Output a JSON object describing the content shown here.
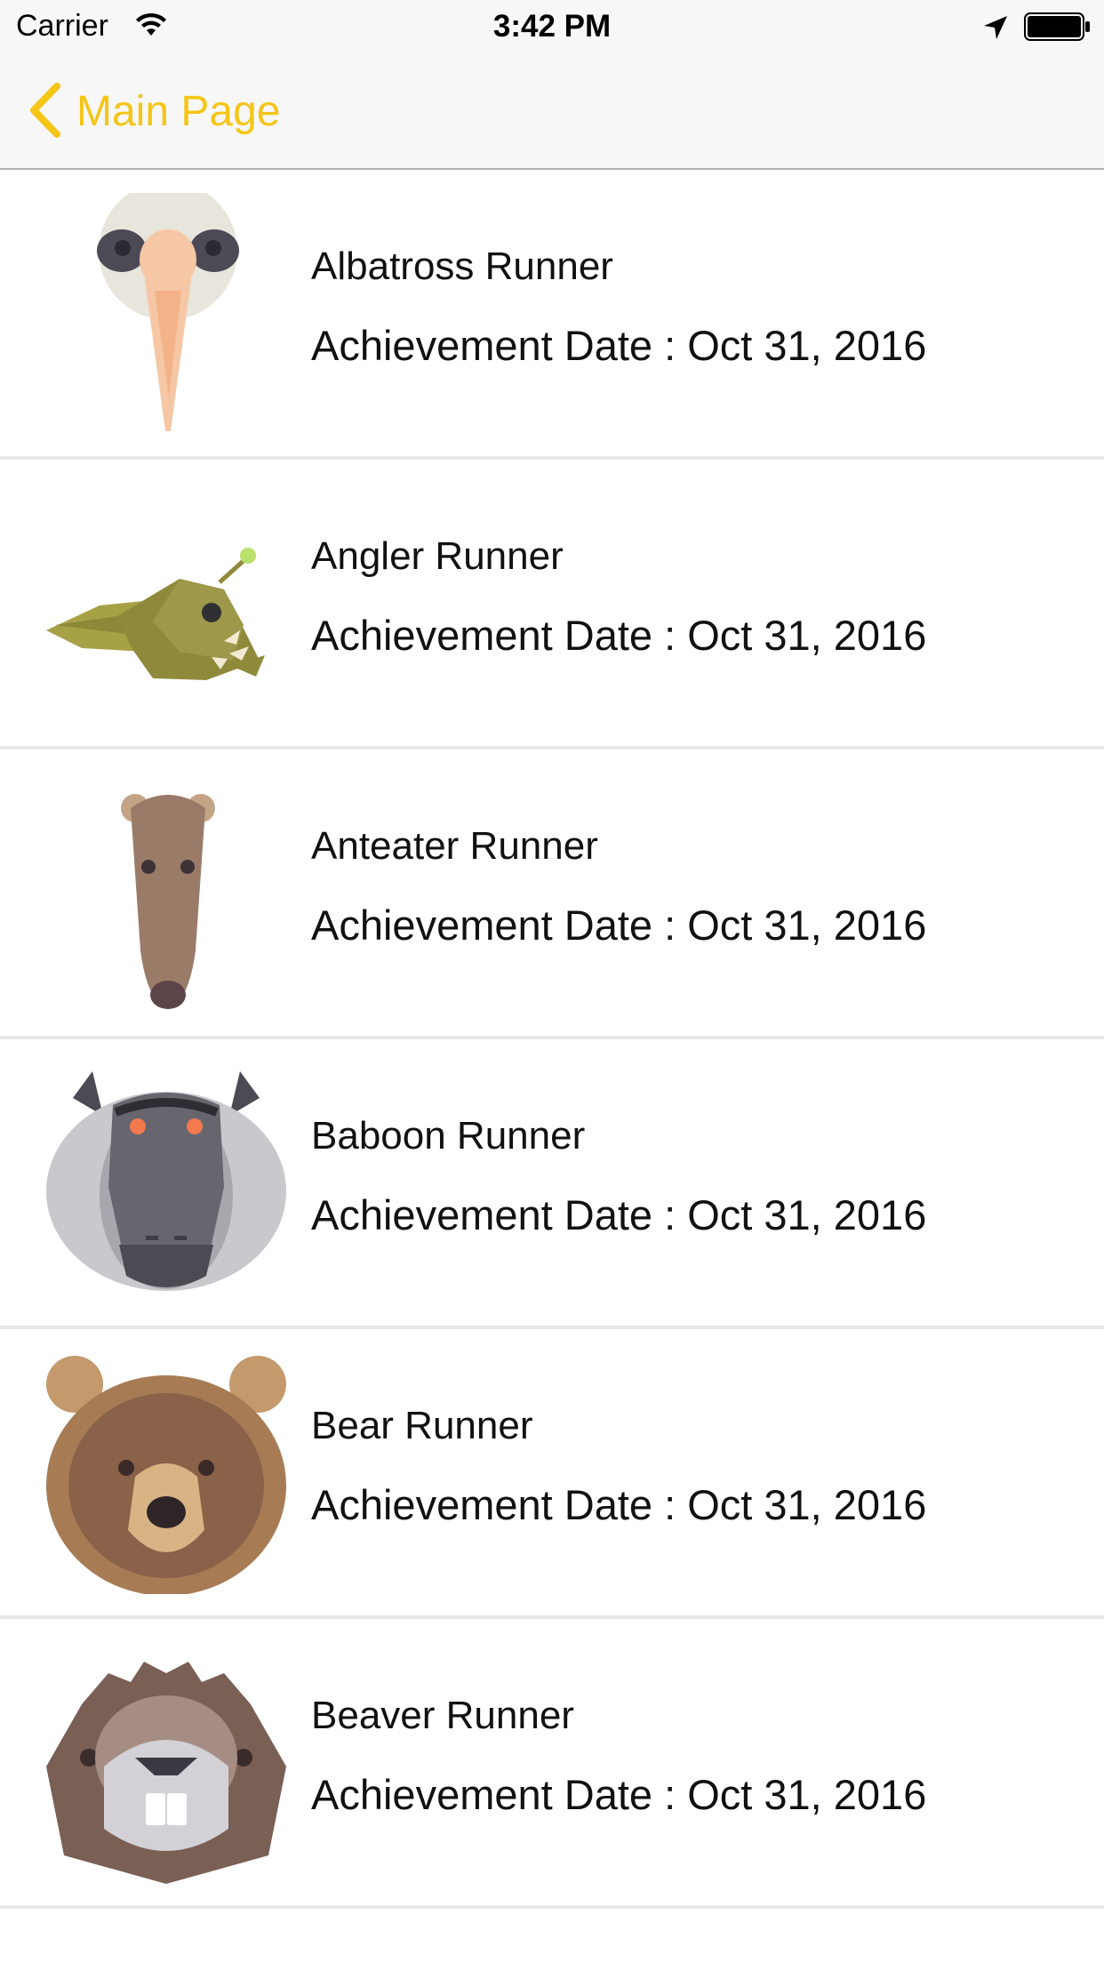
{
  "status_bar": {
    "carrier": "Carrier",
    "time": "3:42 PM",
    "wifi_icon": "wifi-icon",
    "location_icon": "location-arrow-icon",
    "battery_icon": "battery-icon"
  },
  "nav": {
    "back_label": "Main Page",
    "back_icon": "chevron-left-icon",
    "accent_color": "#f5c518"
  },
  "achievements": [
    {
      "title": "Albatross Runner",
      "date": "Achievement Date : Oct 31, 2016",
      "icon": "albatross-icon"
    },
    {
      "title": "Angler Runner",
      "date": "Achievement Date : Oct 31, 2016",
      "icon": "anglerfish-icon"
    },
    {
      "title": "Anteater Runner",
      "date": "Achievement Date : Oct 31, 2016",
      "icon": "anteater-icon"
    },
    {
      "title": "Baboon Runner",
      "date": "Achievement Date : Oct 31, 2016",
      "icon": "baboon-icon"
    },
    {
      "title": "Bear Runner",
      "date": "Achievement Date : Oct 31, 2016",
      "icon": "bear-icon"
    },
    {
      "title": "Beaver Runner",
      "date": "Achievement Date : Oct 31, 2016",
      "icon": "beaver-icon"
    }
  ]
}
